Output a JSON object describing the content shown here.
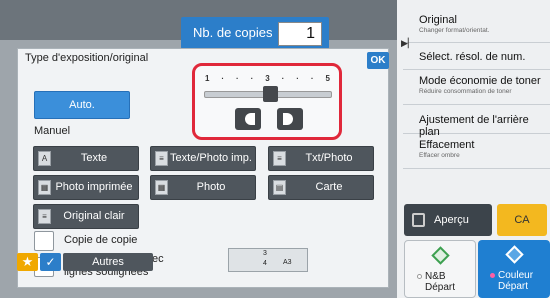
{
  "copies": {
    "label": "Nb. de copies",
    "value": "1"
  },
  "right_panel": {
    "items": [
      {
        "title": "Original",
        "subtitle": "Changer format/orientat."
      },
      {
        "title": "Sélect. résol. de num.",
        "subtitle": ""
      },
      {
        "title": "Mode économie de toner",
        "subtitle": "Réduire consommation de toner"
      },
      {
        "title": "Ajustement de l'arrière plan",
        "subtitle": ""
      },
      {
        "title": "Effacement",
        "subtitle": "Effacer ombre"
      }
    ]
  },
  "dialog": {
    "title": "Type d'exposition/original",
    "ok_label": "OK",
    "auto_label": "Auto.",
    "manual_label": "Manuel",
    "exposure": {
      "labels": [
        "1",
        "·",
        "·",
        "·",
        "3",
        "·",
        "·",
        "·",
        "5"
      ],
      "level": 3
    },
    "modes": [
      {
        "label": "Texte",
        "icon": "A"
      },
      {
        "label": "Texte/Photo imp.",
        "icon": "≡"
      },
      {
        "label": "Txt/Photo",
        "icon": "≡"
      },
      {
        "label": "Photo imprimée",
        "icon": "▦"
      },
      {
        "label": "Photo",
        "icon": "▦"
      },
      {
        "label": "Carte",
        "icon": "▤"
      },
      {
        "label": "Original clair",
        "icon": "≡"
      }
    ],
    "checkboxes": [
      {
        "label": "Copie de copie"
      },
      {
        "label": "Copie originale avec lignes soulignées"
      }
    ]
  },
  "tray": {
    "n1": "3",
    "n2": "4",
    "paper": "A3"
  },
  "bottom": {
    "autres_label": "Autres"
  },
  "actions": {
    "apercu_label": "Aperçu",
    "ca_label": "CA",
    "bw_label1": "N&B",
    "bw_label2": "Départ",
    "color_label1": "Couleur",
    "color_label2": "Départ"
  },
  "colors": {
    "accent": "#2c7ec9",
    "highlight": "#e0283a",
    "color_start": "#1f7fd1",
    "ca": "#f3b81f"
  }
}
